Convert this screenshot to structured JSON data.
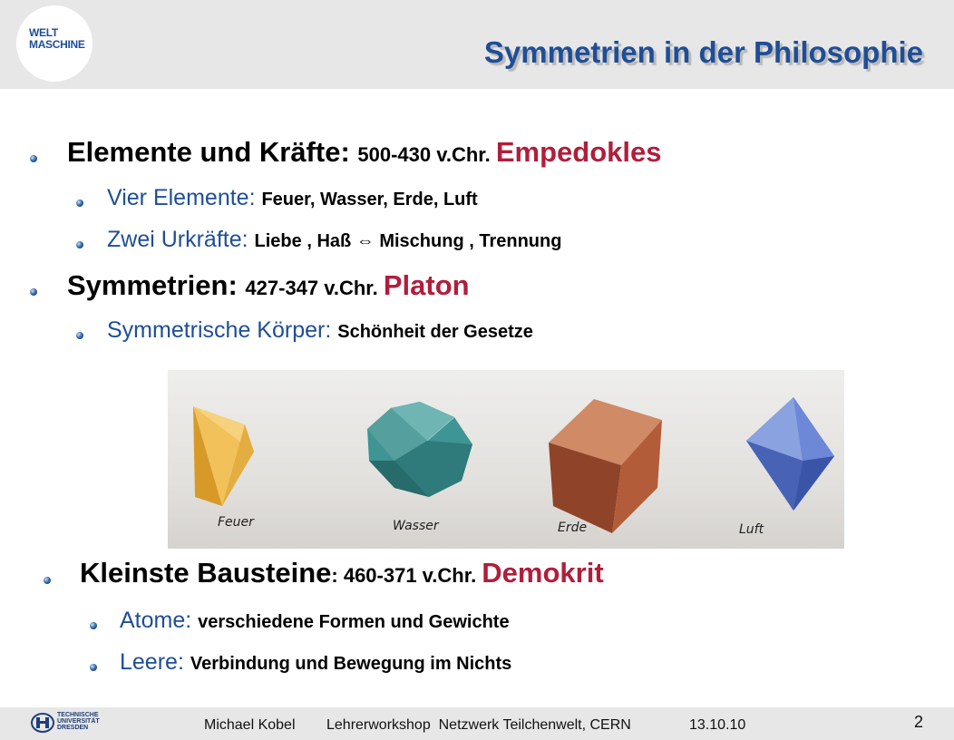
{
  "header": {
    "logo": {
      "line1": "WELT",
      "line2": "MASCHINE"
    },
    "title": "Symmetrien in der  Philosophie"
  },
  "content": {
    "item1": {
      "label": "Elemente und Kräfte: ",
      "date": "500-430 v.Chr. ",
      "name": "Empedokles"
    },
    "item1a": {
      "label": "Vier Elemente: ",
      "detail": "Feuer, Wasser, Erde, Luft"
    },
    "item1b": {
      "label": "Zwei Urkräfte: ",
      "detail1": "Liebe , Haß ",
      "arrow": "⇔",
      "detail2": " Mischung , Trennung"
    },
    "item2": {
      "label": "Symmetrien: ",
      "date": "427-347 v.Chr. ",
      "name": "Platon"
    },
    "item2a": {
      "label": "Symmetrische Körper: ",
      "detail": "Schönheit der Gesetze"
    },
    "item3": {
      "label": "Kleinste Bausteine",
      "colon": ": ",
      "date": "460-371 v.Chr. ",
      "name": "Demokrit"
    },
    "item3a": {
      "label": "Atome: ",
      "detail": "verschiedene Formen und Gewichte"
    },
    "item3b": {
      "label": "Leere: ",
      "detail": "Verbindung und Bewegung im Nichts"
    }
  },
  "figure": {
    "labels": [
      "Feuer",
      "Wasser",
      "Erde",
      "Luft"
    ],
    "colors": {
      "fire": "#e8a936",
      "water": "#3b8c8c",
      "earth": "#b35d3a",
      "air": "#5a73c4"
    }
  },
  "footer": {
    "university": [
      "TECHNISCHE",
      "UNIVERSITÄT",
      "DRESDEN"
    ],
    "author": "Michael Kobel",
    "event": "Lehrerworkshop  Netzwerk Teilchenwelt, CERN",
    "date": "13.10.10",
    "page": "2"
  }
}
